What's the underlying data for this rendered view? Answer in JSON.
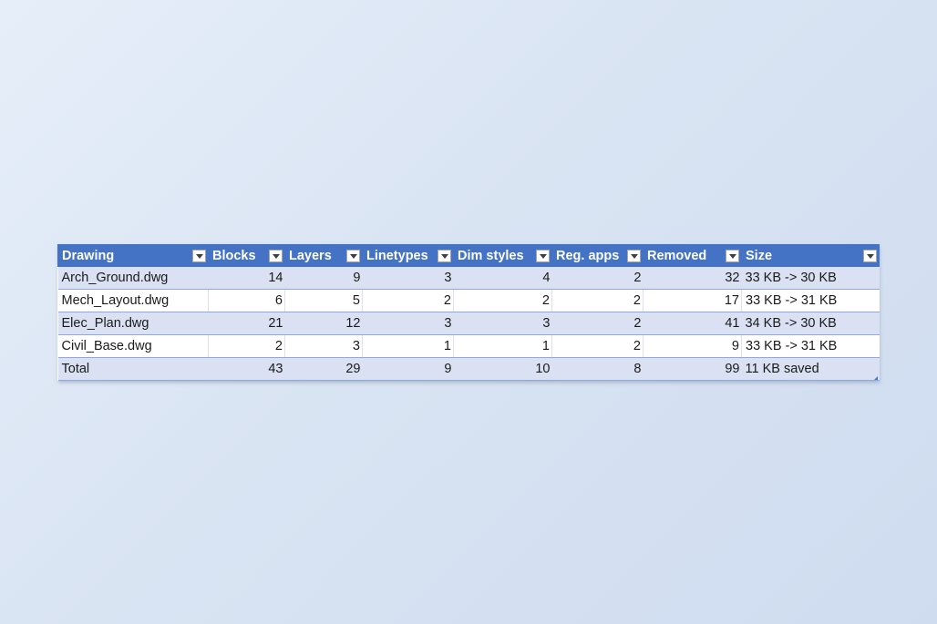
{
  "table": {
    "columns": [
      {
        "key": "drawing",
        "label": "Drawing"
      },
      {
        "key": "blocks",
        "label": "Blocks"
      },
      {
        "key": "layers",
        "label": "Layers"
      },
      {
        "key": "linetypes",
        "label": "Linetypes"
      },
      {
        "key": "dim_styles",
        "label": "Dim styles"
      },
      {
        "key": "reg_apps",
        "label": "Reg. apps"
      },
      {
        "key": "removed",
        "label": "Removed"
      },
      {
        "key": "size",
        "label": "Size"
      }
    ],
    "rows": [
      {
        "drawing": "Arch_Ground.dwg",
        "blocks": "14",
        "layers": "9",
        "linetypes": "3",
        "dim_styles": "4",
        "reg_apps": "2",
        "removed": "32",
        "size": "33 KB -> 30 KB"
      },
      {
        "drawing": "Mech_Layout.dwg",
        "blocks": "6",
        "layers": "5",
        "linetypes": "2",
        "dim_styles": "2",
        "reg_apps": "2",
        "removed": "17",
        "size": "33 KB -> 31 KB"
      },
      {
        "drawing": "Elec_Plan.dwg",
        "blocks": "21",
        "layers": "12",
        "linetypes": "3",
        "dim_styles": "3",
        "reg_apps": "2",
        "removed": "41",
        "size": "34 KB -> 30 KB"
      },
      {
        "drawing": "Civil_Base.dwg",
        "blocks": "2",
        "layers": "3",
        "linetypes": "1",
        "dim_styles": "1",
        "reg_apps": "2",
        "removed": "9",
        "size": "33 KB -> 31 KB"
      }
    ],
    "total": {
      "drawing": "Total",
      "blocks": "43",
      "layers": "29",
      "linetypes": "9",
      "dim_styles": "10",
      "reg_apps": "8",
      "removed": "99",
      "size": "11 KB saved"
    }
  },
  "icons": {
    "filter": "filter-dropdown-icon",
    "resize": "table-resize-handle-icon"
  },
  "colors": {
    "header_bg": "#4472c4",
    "band_bg": "#d9e1f2",
    "border": "#8ea9db"
  }
}
